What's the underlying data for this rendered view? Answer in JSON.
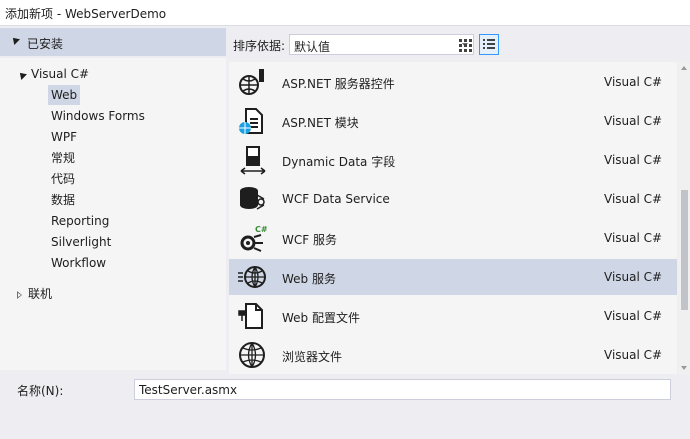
{
  "window": {
    "title": "添加新项 - WebServerDemo"
  },
  "installed_header": {
    "label": "已安装"
  },
  "tree": {
    "visual_csharp": "Visual C#",
    "children": [
      "Web",
      "Windows Forms",
      "WPF",
      "常规",
      "代码",
      "数据",
      "Reporting",
      "Silverlight",
      "Workflow"
    ],
    "selected": "Web",
    "online": "联机"
  },
  "sortbar": {
    "label": "排序依据:",
    "value": "默认值"
  },
  "items": [
    {
      "name": "ASP.NET 服务器控件",
      "lang": "Visual C#",
      "icon": "server-control-icon"
    },
    {
      "name": "ASP.NET 模块",
      "lang": "Visual C#",
      "icon": "module-icon"
    },
    {
      "name": "Dynamic Data 字段",
      "lang": "Visual C#",
      "icon": "dynamic-data-icon"
    },
    {
      "name": "WCF Data Service",
      "lang": "Visual C#",
      "icon": "wcf-data-service-icon"
    },
    {
      "name": "WCF 服务",
      "lang": "Visual C#",
      "icon": "wcf-service-icon"
    },
    {
      "name": "Web 服务",
      "lang": "Visual C#",
      "icon": "web-service-icon"
    },
    {
      "name": "Web 配置文件",
      "lang": "Visual C#",
      "icon": "web-config-icon"
    },
    {
      "name": "浏览器文件",
      "lang": "Visual C#",
      "icon": "browser-file-icon"
    }
  ],
  "selected_item": "Web 服务",
  "bottom": {
    "name_label": "名称(N):",
    "name_value": "TestServer.asmx"
  },
  "colors": {
    "selection": "#cfd6e5",
    "accent": "#3399ff",
    "background": "#eeeef2"
  }
}
